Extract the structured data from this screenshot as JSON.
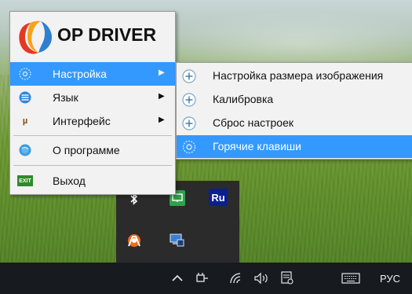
{
  "app": {
    "logo_text": "OP DRIVER"
  },
  "main_menu": {
    "items": [
      {
        "label": "Настройка",
        "icon": "settings-gear-icon",
        "has_submenu": true,
        "selected": true
      },
      {
        "label": "Язык",
        "icon": "language-list-icon",
        "has_submenu": true,
        "selected": false
      },
      {
        "label": "Интерфейс",
        "icon": "interface-icon",
        "has_submenu": true,
        "selected": false
      },
      {
        "label": "О программе",
        "icon": "about-globe-icon",
        "has_submenu": false,
        "selected": false
      },
      {
        "label": "Выход",
        "icon": "exit-icon",
        "has_submenu": false,
        "selected": false
      }
    ]
  },
  "submenu": {
    "items": [
      {
        "label": "Настройка размера изображения",
        "icon": "plus-circle-icon",
        "selected": false
      },
      {
        "label": "Калибровка",
        "icon": "plus-circle-icon",
        "selected": false
      },
      {
        "label": "Сброс настроек",
        "icon": "plus-circle-icon",
        "selected": false
      },
      {
        "label": "Горячие клавиши",
        "icon": "hotkey-gear-icon",
        "selected": true
      }
    ]
  },
  "tray_popup": {
    "language_badge": "Ru",
    "exit_icon_text": "EXIT",
    "interface_icon_text": "µ"
  },
  "taskbar": {
    "language": "РУС"
  },
  "colors": {
    "selection": "#3399ff",
    "menu_bg": "#f2f2f2",
    "taskbar_bg": "#171a1f",
    "tray_bg": "#2b2b2b"
  }
}
